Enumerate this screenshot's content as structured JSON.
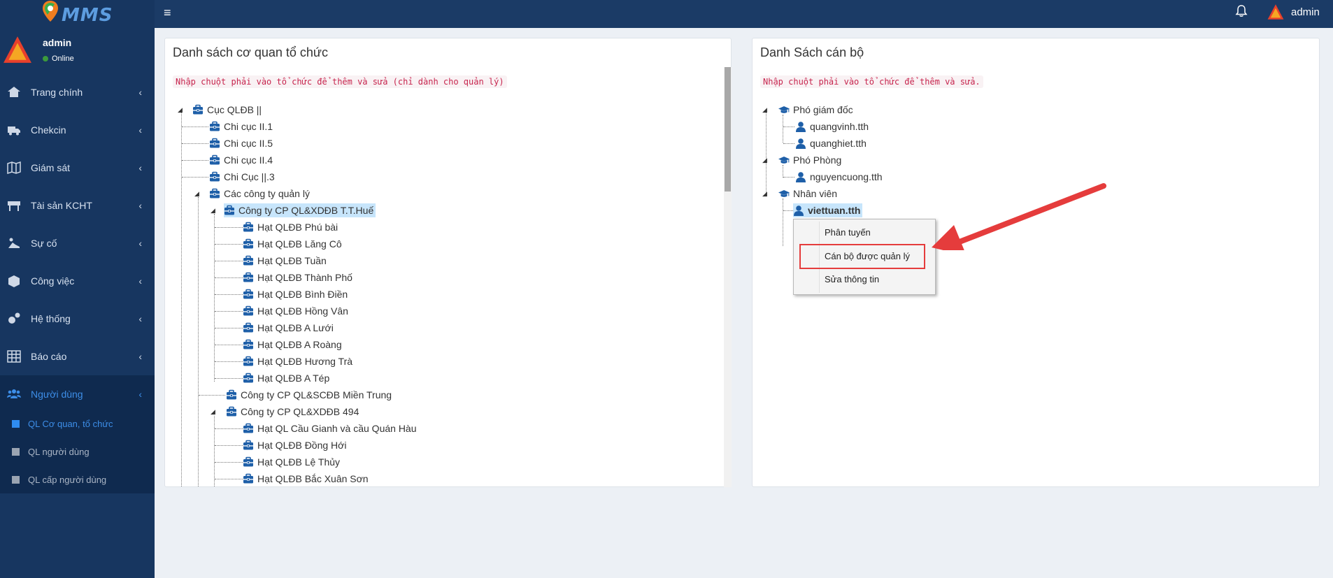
{
  "topbar": {
    "logo_text": "MMS",
    "menu_toggle": "≡",
    "user_name": "admin"
  },
  "sidebar": {
    "user": {
      "name": "admin",
      "status": "Online"
    },
    "items": [
      {
        "label": "Trang chính",
        "icon": "home-icon"
      },
      {
        "label": "Chekcin",
        "icon": "truck-icon"
      },
      {
        "label": "Giám sát",
        "icon": "map-icon"
      },
      {
        "label": "Tài sản KCHT",
        "icon": "road-barrier-icon"
      },
      {
        "label": "Sự cố",
        "icon": "accident-icon"
      },
      {
        "label": "Công việc",
        "icon": "box-icon"
      },
      {
        "label": "Hệ thống",
        "icon": "gears-icon"
      },
      {
        "label": "Báo cáo",
        "icon": "table-icon"
      },
      {
        "label": "Người dùng",
        "icon": "users-icon"
      }
    ],
    "chevron": "‹",
    "subitems": [
      {
        "label": "QL Cơ quan, tổ chức"
      },
      {
        "label": "QL người dùng"
      },
      {
        "label": "QL cấp người dùng"
      }
    ]
  },
  "left_panel": {
    "title": "Danh sách cơ quan tổ chức",
    "hint": "Nhập chuột phải vào tổ chức để thêm và sửa (chỉ dành cho quản lý)",
    "tree": [
      "Cục QLĐB ||",
      "Chi cục II.1",
      "Chi cục II.5",
      "Chi cục II.4",
      "Chi Cục ||.3",
      "Các công ty quản lý",
      "Công ty CP QL&XDĐB T.T.Huế",
      "Hạt QLĐB Phú bài",
      "Hạt QLĐB Lăng Cô",
      "Hạt QLĐB Tuần",
      "Hạt QLĐB Thành Phố",
      "Hạt QLĐB Bình Điền",
      "Hạt QLĐB Hồng Vân",
      "Hạt QLĐB A Lưới",
      "Hạt QLĐB A Roàng",
      "Hạt QLĐB Hương Trà",
      "Hạt QLĐB A Tép",
      "Công ty CP QL&SCĐB Miền Trung",
      "Công ty CP QL&XDĐB 494",
      "Hạt QL Cầu Gianh và cầu Quán Hàu",
      "Hạt QLĐB Đồng Hới",
      "Hạt QLĐB Lệ Thủy",
      "Hạt QLĐB Bắc Xuân Sơn"
    ]
  },
  "right_panel": {
    "title": "Danh Sách cán bộ",
    "hint": "Nhập chuột phải vào tổ chức để thêm và sửa.",
    "tree": [
      "Phó giám đốc",
      "quangvinh.tth",
      "quanghiet.tth",
      "Phó Phòng",
      "nguyencuong.tth",
      "Nhân viên",
      "viettuan.tth"
    ]
  },
  "context_menu": {
    "items": [
      "Phân tuyến",
      "Cán bộ được quản lý",
      "Sửa thông tin"
    ]
  },
  "colors": {
    "topbar": "#1b3b66",
    "sidebar": "#173660",
    "accent": "#3d8ee8",
    "highlight": "#e53c3c",
    "selected_node": "#c7e5fb"
  }
}
